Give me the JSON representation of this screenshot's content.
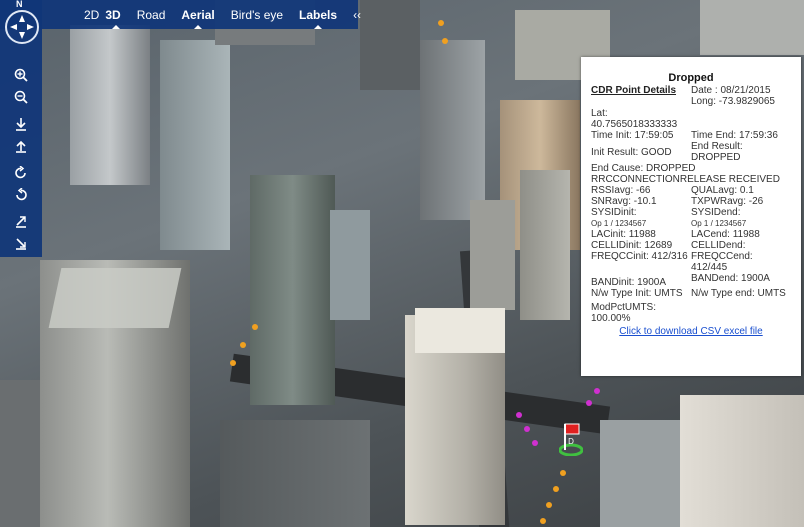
{
  "toolbar": {
    "compass_n": "N",
    "mode_2d": "2D",
    "mode_3d": "3D",
    "road": "Road",
    "aerial": "Aerial",
    "birds_eye": "Bird's eye",
    "labels": "Labels",
    "collapse": "‹‹"
  },
  "navbar": {
    "zoom_in_icon": "zoom-in-icon",
    "zoom_out_icon": "zoom-out-icon",
    "tilt_down_icon": "tilt-down-icon",
    "tilt_up_icon": "tilt-up-icon",
    "rotate_cw_icon": "rotate-cw-icon",
    "rotate_ccw_icon": "rotate-ccw-icon",
    "pitch_down_icon": "pitch-down-icon",
    "pitch_up_icon": "pitch-up-icon"
  },
  "popup": {
    "title": "Dropped",
    "section_label": "CDR Point Details",
    "date": "Date : 08/21/2015",
    "lat": "Lat: 40.7565018333333",
    "long": "Long: -73.9829065",
    "time_init": "Time Init: 17:59:05",
    "time_end": "Time End: 17:59:36",
    "init_result": "Init Result: GOOD",
    "end_result": "End Result: DROPPED",
    "end_cause": "End Cause: DROPPED RRCCONNECTIONRELEASE RECEIVED",
    "rssi": "RSSIavg: -66",
    "qual": "QUALavg: 0.1",
    "snr": "SNRavg: -10.1",
    "txpwr": "TXPWRavg: -26",
    "sysid_init": "SYSIDinit:",
    "sysid_init_val": "Op 1 / 1234567",
    "sysid_end": "SYSIDend:",
    "sysid_end_val": "Op 1 / 1234567",
    "lac_init": "LACinit: 11988",
    "lac_end": "LACend: 11988",
    "cellid_init": "CELLIDinit: 12689",
    "cellid_end": "CELLIDend:",
    "freq_init": "FREQCCinit: 412/316",
    "freq_end": "FREQCCend: 412/445",
    "band_init": "BANDinit: 1900A",
    "band_end": "BANDend: 1900A",
    "nw_init": "N/w Type Init: UMTS",
    "nw_end": "N/w Type end: UMTS",
    "modpct": "ModPctUMTS: 100.00%",
    "csv_link": "Click to download CSV excel file"
  },
  "colors": {
    "toolbar_bg": "#10367a",
    "link": "#1a4fcf",
    "route_orange": "#f0a020",
    "route_magenta": "#d030d0",
    "marker_red": "#e02020",
    "marker_green": "#40c040"
  }
}
